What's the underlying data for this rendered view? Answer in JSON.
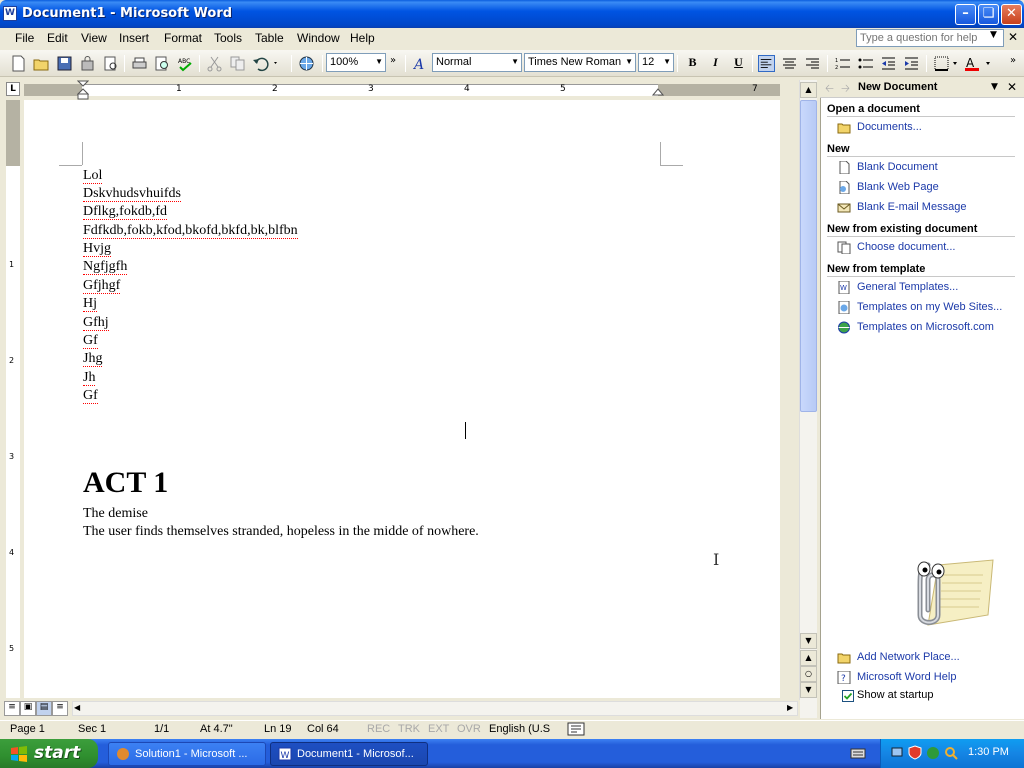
{
  "window": {
    "title": "Document1 - Microsoft Word",
    "app_icon": "W"
  },
  "menu": [
    "File",
    "Edit",
    "View",
    "Insert",
    "Format",
    "Tools",
    "Table",
    "Window",
    "Help"
  ],
  "help_box": {
    "placeholder": "Type a question for help"
  },
  "toolbar": {
    "zoom": "100%",
    "style": "Normal",
    "font": "Times New Roman",
    "size": "12",
    "bold": "B",
    "italic": "I",
    "underline": "U"
  },
  "ruler": {
    "numbers": [
      "1",
      "2",
      "3",
      "4",
      "5",
      "7"
    ]
  },
  "vruler": {
    "numbers": [
      "1",
      "2",
      "3",
      "4",
      "5"
    ]
  },
  "document": {
    "lines": [
      "Lol",
      "Dskvhudsvhuifds",
      "Dflkg,fokdb,fd",
      "Fdfkdb,fokb,kfod,bkofd,bkfd,bk,blfbn",
      "Hvjg",
      "Ngfjgfh",
      "Gfjhgf",
      "Hj",
      "Gfhj",
      "Gf",
      "Jhg",
      "Jh",
      "Gf"
    ],
    "heading": "ACT 1",
    "subtitle": "The demise",
    "body": "The user finds themselves stranded, hopeless in the midde of nowhere."
  },
  "status": {
    "page": "Page  1",
    "sec": "Sec  1",
    "pages": "1/1",
    "at": "At  4.7\"",
    "ln": "Ln  19",
    "col": "Col  64",
    "rec": "REC",
    "trk": "TRK",
    "ext": "EXT",
    "ovr": "OVR",
    "lang": "English (U.S"
  },
  "taskpane": {
    "title": "New Document",
    "open_heading": "Open a document",
    "documents": "Documents...",
    "new_heading": "New",
    "blank_document": "Blank Document",
    "blank_web_page": "Blank Web Page",
    "blank_email": "Blank E-mail Message",
    "existing_heading": "New from existing document",
    "choose_document": "Choose document...",
    "template_heading": "New from template",
    "general_templates": "General Templates...",
    "templates_web": "Templates on my Web Sites...",
    "templates_ms": "Templates on Microsoft.com",
    "add_network": "Add Network Place...",
    "word_help": "Microsoft Word Help",
    "show_startup": "Show at startup"
  },
  "taskbar": {
    "start": "start",
    "task1": "Solution1 - Microsoft ...",
    "task2": "Document1 - Microsof...",
    "clock": "1:30 PM"
  },
  "colors": {
    "title_blue": "#0054E3",
    "link_blue": "#1C3AA9",
    "start_green": "#2F8F2F",
    "taskbar_blue": "#245EDB"
  }
}
